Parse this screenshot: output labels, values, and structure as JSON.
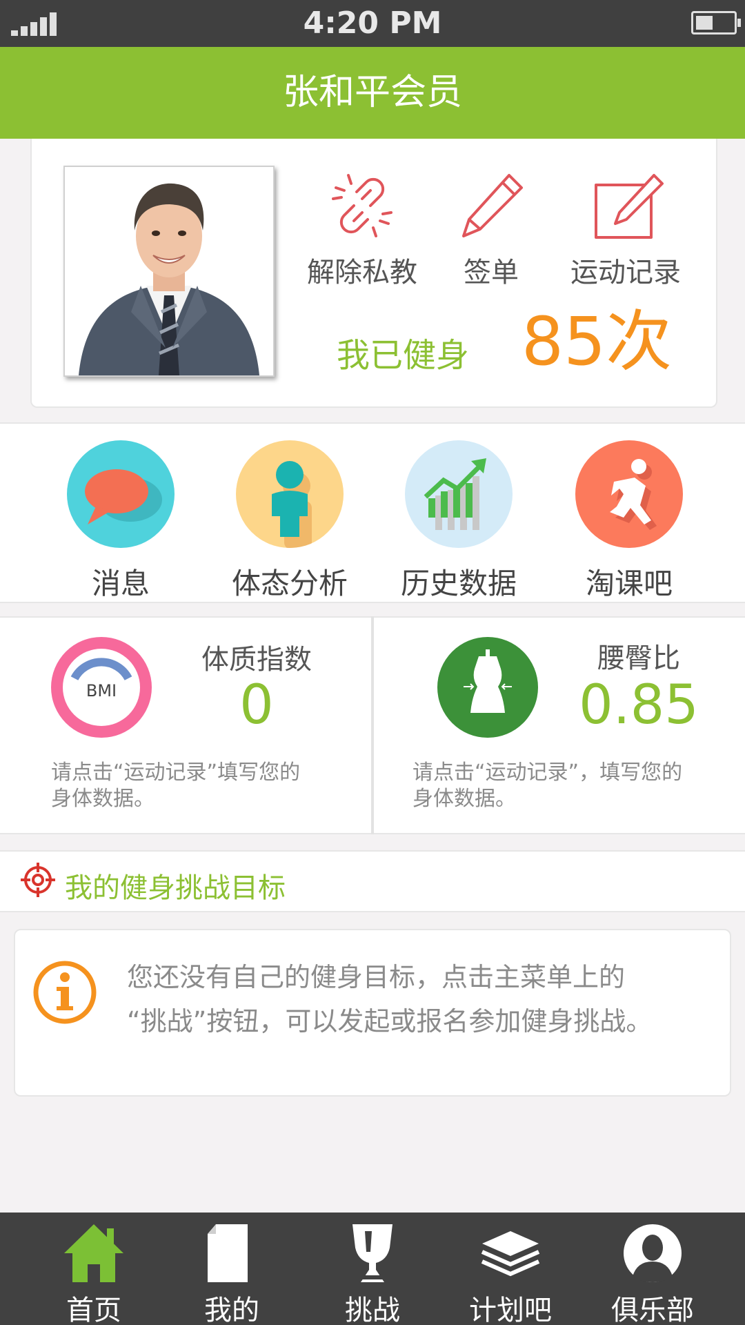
{
  "status_bar": {
    "time": "4:20 PM"
  },
  "header": {
    "title": "张和平会员"
  },
  "profile": {
    "quick_actions": [
      {
        "label": "解除私教",
        "icon": "unlink-icon"
      },
      {
        "label": "签单",
        "icon": "pencil-icon"
      },
      {
        "label": "运动记录",
        "icon": "edit-record-icon"
      }
    ],
    "fitness_label": "我已健身",
    "fitness_count": "85次"
  },
  "features": [
    {
      "label": "消息",
      "icon": "speech-bubble-icon",
      "color": "#4fd2dc"
    },
    {
      "label": "体态分析",
      "icon": "person-icon",
      "color": "#fdd68a"
    },
    {
      "label": "历史数据",
      "icon": "growth-chart-icon",
      "color": "#d4ebf8"
    },
    {
      "label": "淘课吧",
      "icon": "running-man-icon",
      "color": "#fc7a5c"
    }
  ],
  "metrics": {
    "bmi": {
      "icon_text": "BMI",
      "title": "体质指数",
      "value": "0",
      "note_line1": "请点击“运动记录”填写您的",
      "note_line2": "身体数据。"
    },
    "whr": {
      "title": "腰臀比",
      "value": "0.85",
      "note_line1": "请点击“运动记录”，填写您的",
      "note_line2": "身体数据。"
    }
  },
  "goal": {
    "title": "我的健身挑战目标",
    "message_line1": "您还没有自己的健身目标，点击主菜单上的",
    "message_line2": "“挑战”按钮，可以发起或报名参加健身挑战。"
  },
  "bottom_nav": [
    {
      "label": "首页",
      "icon": "home-icon",
      "active": true
    },
    {
      "label": "我的",
      "icon": "document-icon"
    },
    {
      "label": "挑战",
      "icon": "trophy-icon"
    },
    {
      "label": "计划吧",
      "icon": "layers-icon"
    },
    {
      "label": "俱乐部",
      "icon": "user-silhouette-icon"
    }
  ],
  "colors": {
    "brand_green": "#8cc033",
    "accent_orange": "#f5921e",
    "nav_bg": "#414141"
  }
}
